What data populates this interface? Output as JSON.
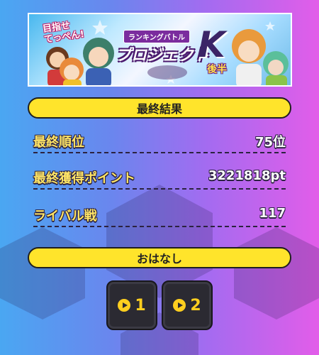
{
  "banner": {
    "catchphrase_line1": "目指せ",
    "catchphrase_line2": "てっぺん!",
    "subtitle": "ランキングバトル",
    "logo_text": "プロジェクト",
    "logo_letter": "K",
    "part_label": "後半"
  },
  "final_results": {
    "header": "最終結果",
    "rows": [
      {
        "label": "最終順位",
        "value": "75位"
      },
      {
        "label": "最終獲得ポイント",
        "value": "3221818pt"
      },
      {
        "label": "ライバル戦",
        "value": "117"
      }
    ]
  },
  "story": {
    "header": "おはなし",
    "episodes": [
      {
        "number": "1"
      },
      {
        "number": "2"
      }
    ]
  },
  "colors": {
    "pill_yellow": "#ffe42b",
    "label_yellow": "#ffe566",
    "play_yellow": "#ffcf1f",
    "button_dark": "#2b2a32"
  }
}
